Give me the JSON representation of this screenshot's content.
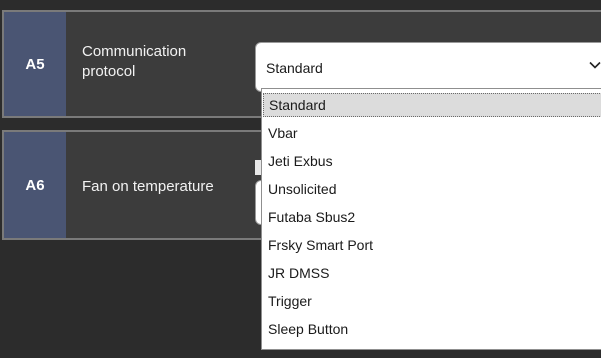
{
  "rows": [
    {
      "id": "A5",
      "label": "Communication protocol"
    },
    {
      "id": "A6",
      "label": "Fan on temperature"
    }
  ],
  "select": {
    "value": "Standard",
    "icon": "chevron-down-icon"
  },
  "dropdown": {
    "options": [
      "Standard",
      "Vbar",
      "Jeti Exbus",
      "Unsolicited",
      "Futaba Sbus2",
      "Frsky Smart Port",
      "JR DMSS",
      "Trigger",
      "Sleep Button"
    ],
    "selected_index": 0
  }
}
